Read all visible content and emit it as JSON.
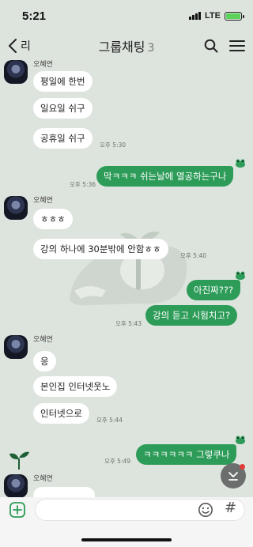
{
  "status_bar": {
    "time": "5:21",
    "network": "LTE"
  },
  "header": {
    "back_label": "리",
    "title": "그룹채팅",
    "member_count": "3"
  },
  "chat": {
    "groups": [
      {
        "sender": "오혜연",
        "messages": [
          "평일에 한번",
          "일요일 쉬구",
          "공휴일 쉬구"
        ],
        "time": "오후 5:30"
      },
      {
        "sender": "오혜연",
        "messages": [
          "ㅎㅎㅎ",
          "강의 하나에 30분밖에 안함ㅎㅎ"
        ],
        "time": "오후 5:40"
      },
      {
        "sender": "오혜연",
        "messages": [
          "응",
          "본인집 인터넷웃노",
          "인터넷으로"
        ],
        "time": "오후 5:44"
      },
      {
        "sender": "오혜연",
        "messages": []
      }
    ],
    "outgoing": [
      {
        "text": "막ㅋㅋㅋ 쉬는날에 열공하는구나",
        "time": "오후 5:36"
      },
      {
        "text": "아진짜???",
        "time": ""
      },
      {
        "text": "강의 듣고 시험치고?",
        "time": "오후 5:43"
      },
      {
        "text": "ㅋㅋㅋㅋㅋㅋ 그렇쿠나",
        "time": "오후 5:49"
      }
    ]
  },
  "input": {
    "placeholder": "",
    "value": ""
  },
  "icons": {
    "back": "chevron-left-icon",
    "search": "search-icon",
    "menu": "hamburger-menu-icon",
    "scroll_down": "scroll-to-bottom-icon",
    "plus": "plus-icon",
    "emoji": "emoji-icon",
    "hash": "#"
  },
  "colors": {
    "outgoing_bubble": "#2e9c59",
    "incoming_bubble": "#ffffff",
    "background": "#dde3dd",
    "accent_plus": "#2e9c59"
  }
}
